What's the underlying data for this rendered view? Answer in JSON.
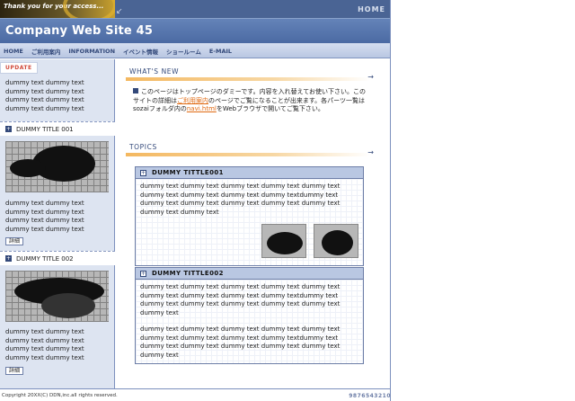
{
  "header": {
    "tagline": "Thank you for your access...",
    "home_link": "HOME",
    "site_title": "Company Web Site 45"
  },
  "nav": {
    "items": [
      "HOME",
      "ご利用案内",
      "INFORMATION",
      "イベント情報",
      "ショールーム",
      "E-MAIL"
    ]
  },
  "sidebar": {
    "update_label": "UPDATE",
    "update_text": "dummy text dummy text dummy text dummy text dummy text dummy text dummy text dummy text",
    "sections": [
      {
        "title": "DUMMY TITLE 001",
        "text": "dummy text dummy text dummy text dummy text dummy text dummy text dummy text dummy text",
        "button": "詳細"
      },
      {
        "title": "DUMMY TITLE 002",
        "text": "dummy text dummy text dummy text dummy text dummy text dummy text dummy text dummy text",
        "button": "詳細"
      }
    ]
  },
  "main": {
    "whats_new_label": "WHAT'S NEW",
    "whats_new_text_1": "このページはトップページのダミーです。内容を入れ替えてお使い下さい。このサイトの詳細は",
    "whats_new_link_1": "ご利用案内",
    "whats_new_text_2": "のページでご覧になることが出来ます。各パーツ一覧はsozaiフォルダ内の",
    "whats_new_link_2": "navi.html",
    "whats_new_text_3": "をWebブラウザで開いてご覧下さい。",
    "topics_label": "TOPICS",
    "topics": [
      {
        "title": "DUMMY TITTLE001",
        "paragraphs": [
          "dummy text dummy text dummy text dummy text dummy text dummy text dummy text dummy text dummy textdummy text dummy text dummy text dummy text dummy text dummy text dummy text dummy text"
        ]
      },
      {
        "title": "DUMMY TITTLE002",
        "paragraphs": [
          "dummy text dummy text dummy text dummy text dummy text dummy text dummy text dummy text dummy textdummy text dummy text dummy text dummy text dummy text dummy text dummy text",
          "dummy text dummy text dummy text dummy text dummy text dummy text dummy text dummy text dummy textdummy text dummy text dummy text dummy text dummy text dummy text dummy text"
        ]
      }
    ]
  },
  "footer": {
    "copyright": "Copyright 20XX(C) DDN,inc.all rights reserved.",
    "code": "9876543210"
  },
  "colors": {
    "primary": "#4b6aa3",
    "accent": "#e06a12",
    "sidebar_bg": "#dde4f1"
  }
}
